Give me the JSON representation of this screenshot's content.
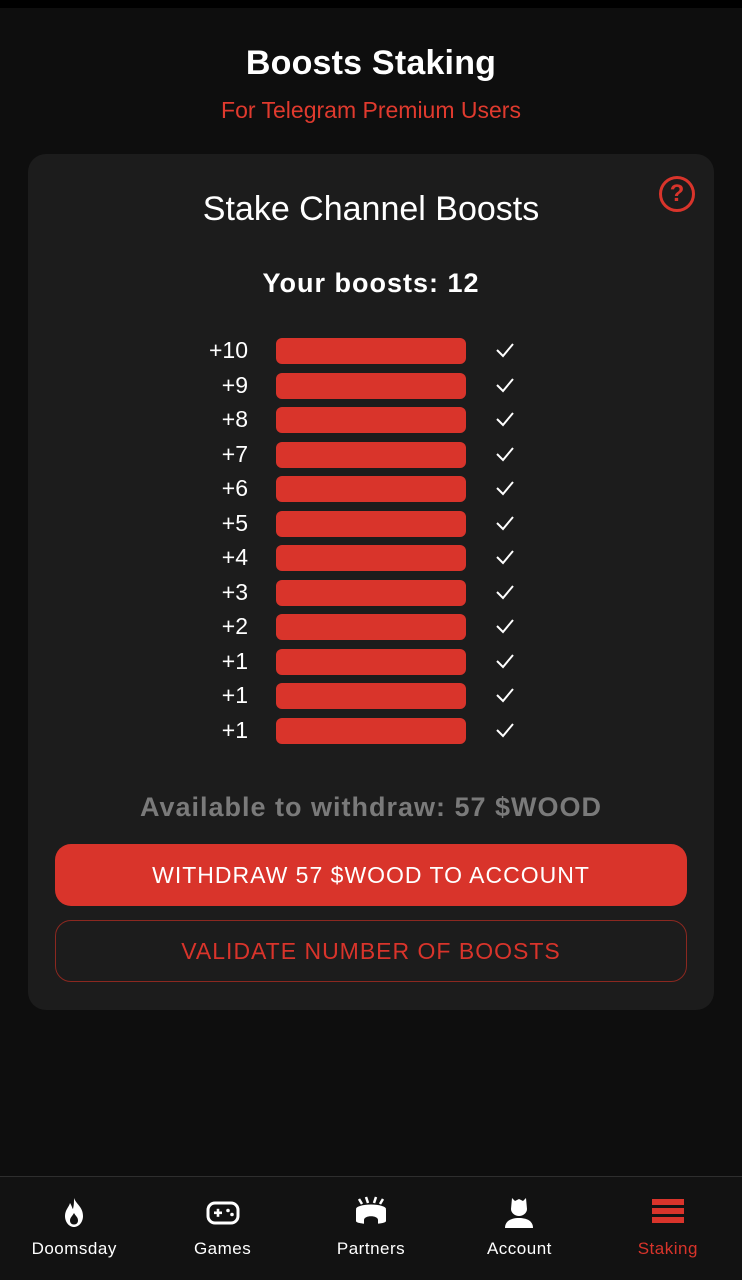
{
  "header": {
    "title": "Boosts Staking",
    "subtitle": "For Telegram Premium Users"
  },
  "card": {
    "title": "Stake Channel Boosts",
    "help_symbol": "?",
    "boosts_text": "Your boosts: 12",
    "boost_rows": [
      {
        "label": "+10",
        "checked": true
      },
      {
        "label": "+9",
        "checked": true
      },
      {
        "label": "+8",
        "checked": true
      },
      {
        "label": "+7",
        "checked": true
      },
      {
        "label": "+6",
        "checked": true
      },
      {
        "label": "+5",
        "checked": true
      },
      {
        "label": "+4",
        "checked": true
      },
      {
        "label": "+3",
        "checked": true
      },
      {
        "label": "+2",
        "checked": true
      },
      {
        "label": "+1",
        "checked": true
      },
      {
        "label": "+1",
        "checked": true
      },
      {
        "label": "+1",
        "checked": true
      }
    ],
    "available_text": "Available to withdraw: 57 $WOOD",
    "withdraw_label": "WITHDRAW 57 $WOOD TO ACCOUNT",
    "validate_label": "VALIDATE NUMBER OF BOOSTS"
  },
  "nav": {
    "items": [
      {
        "label": "Doomsday",
        "icon": "fire-icon",
        "active": false
      },
      {
        "label": "Games",
        "icon": "gamepad-icon",
        "active": false
      },
      {
        "label": "Partners",
        "icon": "stadium-icon",
        "active": false
      },
      {
        "label": "Account",
        "icon": "user-icon",
        "active": false
      },
      {
        "label": "Staking",
        "icon": "stack-icon",
        "active": true
      }
    ]
  },
  "colors": {
    "accent": "#d9342b",
    "background": "#0e0e0e",
    "card": "#1c1c1c",
    "muted_text": "#7a7a7a"
  }
}
